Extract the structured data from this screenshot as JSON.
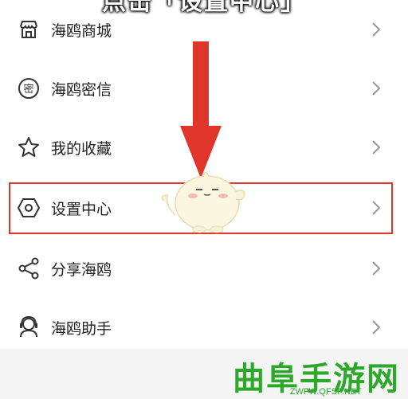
{
  "caption": "点击「设置中心」",
  "menu": {
    "items": [
      {
        "label": "海鸥商城",
        "icon": "store-icon"
      },
      {
        "label": "海鸥密信",
        "icon": "secret-message-icon"
      },
      {
        "label": "我的收藏",
        "icon": "star-icon"
      },
      {
        "label": "设置中心",
        "icon": "settings-hexagon-icon"
      },
      {
        "label": "分享海鸥",
        "icon": "share-icon"
      },
      {
        "label": "海鸥助手",
        "icon": "assistant-headset-icon"
      }
    ]
  },
  "watermark": {
    "title": "曲阜手游网",
    "url": "ZWFW.QFSP.NET"
  },
  "colors": {
    "highlight": "#e0352a",
    "arrow": "#e0352a",
    "watermark": "#2ea82a",
    "icon": "#333333"
  }
}
